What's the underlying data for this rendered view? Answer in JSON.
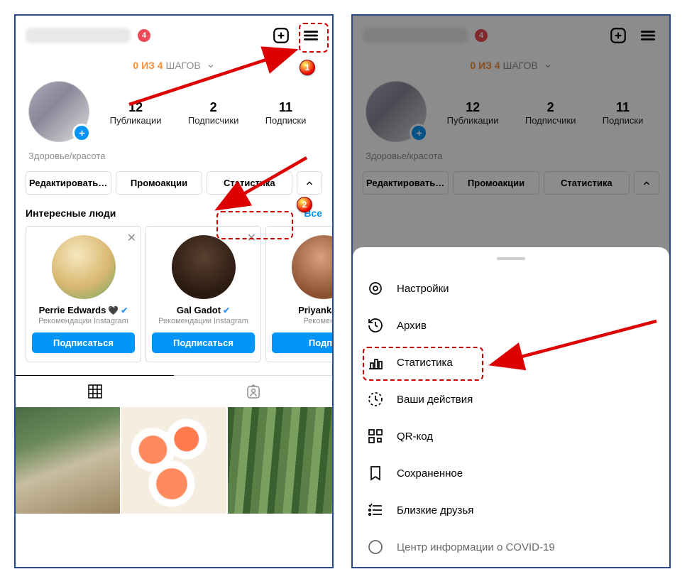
{
  "header": {
    "notification_count": "4"
  },
  "steps": {
    "prefix": "0 ИЗ 4",
    "suffix": "ШАГОВ"
  },
  "stats": {
    "posts": {
      "num": "12",
      "label": "Публикации"
    },
    "followers": {
      "num": "2",
      "label": "Подписчики"
    },
    "following": {
      "num": "11",
      "label": "Подписки"
    }
  },
  "bio": {
    "category": "Здоровье/красота"
  },
  "buttons": {
    "edit": "Редактировать про...",
    "promo": "Промоакции",
    "stats": "Статистика"
  },
  "suggestions": {
    "title": "Интересные люди",
    "all": "Все",
    "cards": [
      {
        "name": "Perrie Edwards",
        "heart": "🖤",
        "verified": true,
        "sub": "Рекомендации Instagram",
        "btn": "Подписаться"
      },
      {
        "name": "Gal Gadot",
        "heart": "",
        "verified": true,
        "sub": "Рекомендации Instagram",
        "btn": "Подписаться"
      },
      {
        "name": "Priyanka Cl",
        "heart": "",
        "verified": false,
        "sub": "Рекоменда",
        "btn": "Подпи"
      }
    ]
  },
  "menu": {
    "settings": "Настройки",
    "archive": "Архив",
    "insights": "Статистика",
    "activity": "Ваши действия",
    "qr": "QR-код",
    "saved": "Сохраненное",
    "close_friends": "Близкие друзья",
    "covid": "Центр информации о COVID-19"
  },
  "callouts": {
    "one": "1",
    "two": "2"
  }
}
